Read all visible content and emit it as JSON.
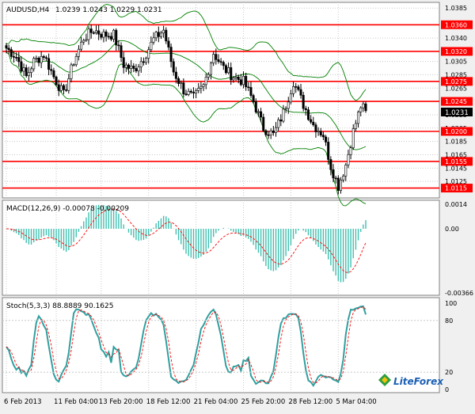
{
  "colors": {
    "background": "#ffffff",
    "frame": "#f0f0f0",
    "grid": "#c8c8c8",
    "bull_candle": "#ffffff",
    "bear_candle": "#000000",
    "candle_outline": "#000000",
    "bollinger": "#008000",
    "level_line": "#ff0000",
    "macd_histogram": "#40c0b0",
    "macd_signal": "#ff0000",
    "stoch_main": "#30a0a0",
    "stoch_signal": "#ff0000",
    "current_price_bg": "#000000",
    "current_price_text": "#ffffff"
  },
  "branding": {
    "logo_text": "LiteForex",
    "logo_icon": "liteforex-logo-icon"
  },
  "chart_data": [
    {
      "id": "price",
      "type": "candlestick",
      "title": "AUDUSD,H4",
      "header_values": [
        "1.0239",
        "1.0243",
        "1.0229",
        "1.0231"
      ],
      "ylim": [
        1.0105,
        1.039
      ],
      "y_ticks": [
        "1.0385",
        "1.0360",
        "1.0340",
        "1.0320",
        "1.0305",
        "1.0285",
        "1.0265",
        "1.0245",
        "1.0225",
        "1.0205",
        "1.0185",
        "1.0165",
        "1.0145",
        "1.0125",
        "1.0115"
      ],
      "level_lines": [
        "1.0360",
        "1.0320",
        "1.0275",
        "1.0245",
        "1.0200",
        "1.0155",
        "1.0115"
      ],
      "current_price": "1.0231",
      "x_labels": [
        "6 Feb 2013",
        "11 Feb 04:00",
        "13 Feb 20:00",
        "18 Feb 12:00",
        "21 Feb 04:00",
        "25 Feb 20:00",
        "28 Feb 12:00",
        "5 Mar 04:00"
      ],
      "close_anchors": [
        [
          0,
          1.0325
        ],
        [
          4,
          1.0312
        ],
        [
          8,
          1.0282
        ],
        [
          11,
          1.0305
        ],
        [
          15,
          1.0315
        ],
        [
          19,
          1.0282
        ],
        [
          23,
          1.0255
        ],
        [
          27,
          1.0305
        ],
        [
          31,
          1.034
        ],
        [
          35,
          1.0352
        ],
        [
          39,
          1.0345
        ],
        [
          43,
          1.0345
        ],
        [
          47,
          1.03
        ],
        [
          51,
          1.0292
        ],
        [
          55,
          1.031
        ],
        [
          59,
          1.0338
        ],
        [
          63,
          1.0352
        ],
        [
          67,
          1.029
        ],
        [
          71,
          1.0262
        ],
        [
          75,
          1.025
        ],
        [
          79,
          1.0268
        ],
        [
          83,
          1.0318
        ],
        [
          87,
          1.0295
        ],
        [
          91,
          1.0282
        ],
        [
          95,
          1.0275
        ],
        [
          99,
          1.0245
        ],
        [
          103,
          1.0205
        ],
        [
          107,
          1.0195
        ],
        [
          111,
          1.0228
        ],
        [
          115,
          1.0275
        ],
        [
          119,
          1.024
        ],
        [
          123,
          1.021
        ],
        [
          127,
          1.0195
        ],
        [
          130,
          1.0148
        ],
        [
          133,
          1.0118
        ],
        [
          136,
          1.015
        ],
        [
          139,
          1.02
        ],
        [
          142,
          1.0238
        ],
        [
          144,
          1.0231
        ]
      ]
    },
    {
      "id": "macd",
      "type": "histogram+line",
      "title": "MACD(12,26,9) -0.00078 -0.00209",
      "ylim": [
        -0.00366,
        0.0014
      ],
      "y_ticks": [
        "0.0014",
        "0.00",
        "-0.00366"
      ]
    },
    {
      "id": "stoch",
      "type": "line",
      "title": "Stoch(5,3,3) 88.8889 90.1625",
      "ylim": [
        0,
        100
      ],
      "y_ticks": [
        "100",
        "80",
        "20",
        "0"
      ]
    }
  ]
}
